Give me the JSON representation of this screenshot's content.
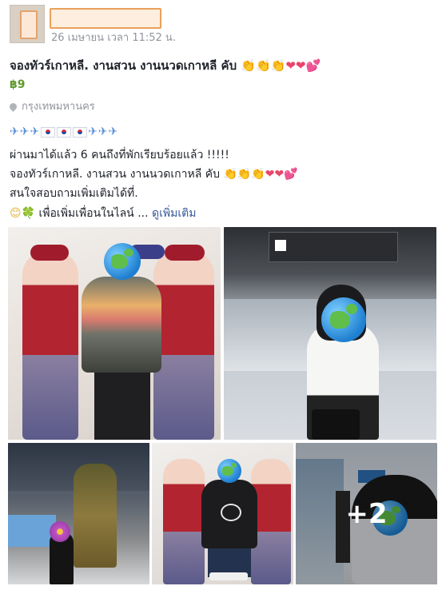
{
  "post": {
    "timestamp": "26 เมษายน เวลา 11:52 น.",
    "title": "จองทัวร์เกาหลี. งานสวน งานนวดเกาหลี คับ",
    "price": "฿9",
    "location": "กรุงเทพมหานคร",
    "body_line_1": "ผ่านมาได้แล้ว 6 คนถึงที่พักเรียบร้อยแล้ว !!!!!",
    "body_line_2": "จองทัวร์เกาหลี. งานสวน งานนวดเกาหลี คับ",
    "body_line_3": "สนใจสอบถามเพิ่มเติมได้ที่.",
    "body_line_4": "เพื่อเพิ่มเพื่อนในไลน์ ...",
    "see_more": "ดูเพิ่มเติม"
  },
  "photos": {
    "more_count": "+2"
  },
  "icons": [
    "clapping-hands-icon",
    "heart-icon",
    "airplane-icon",
    "korea-flag-icon",
    "location-pin-icon",
    "smile-icon",
    "clover-icon",
    "globe-sticker-icon"
  ],
  "colors": {
    "link": "#365899",
    "price": "#5f9a2b",
    "meta": "#90949c"
  }
}
